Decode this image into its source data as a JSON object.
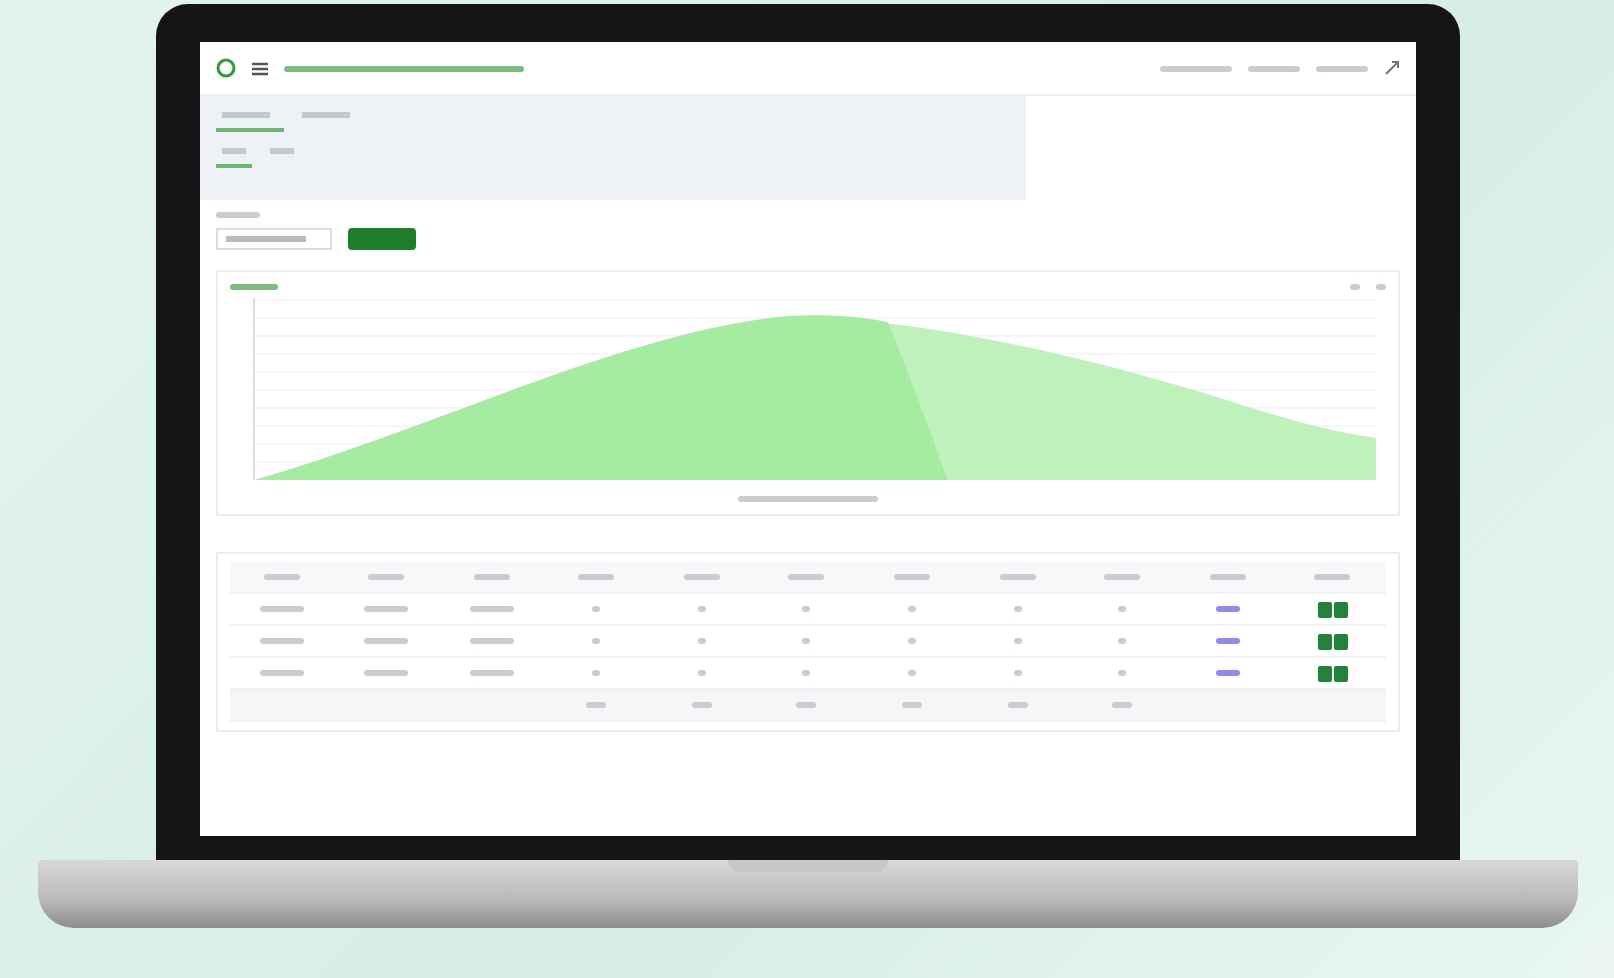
{
  "top_tabs": [
    {
      "selected": true
    },
    {
      "selected": false
    }
  ],
  "sub_tabs": [
    {
      "selected": true
    },
    {
      "selected": false
    }
  ],
  "chart": {
    "series": [
      {
        "color": "#a4eda0"
      },
      {
        "color": "#bff2ba"
      }
    ]
  },
  "table": {
    "rows": [
      {
        "kind": "data"
      },
      {
        "kind": "data"
      },
      {
        "kind": "data"
      },
      {
        "kind": "total"
      }
    ]
  }
}
